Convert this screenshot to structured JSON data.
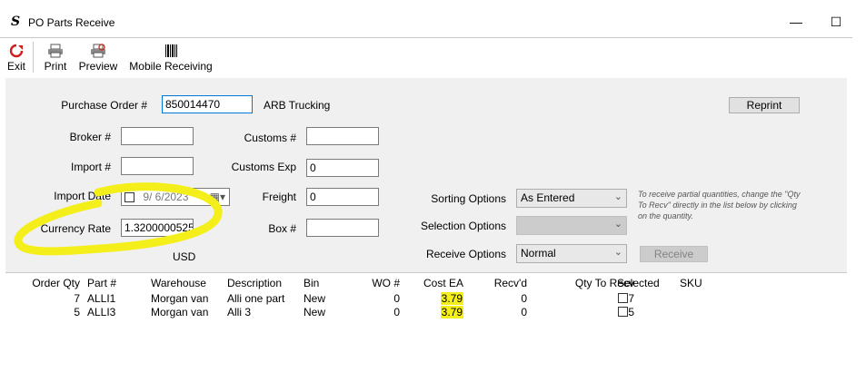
{
  "window": {
    "title": "PO Parts Receive",
    "minimize_label": "—",
    "maximize_label": "☐"
  },
  "toolbar": {
    "exit_label": "Exit",
    "print_label": "Print",
    "preview_label": "Preview",
    "mobile_receiving_label": "Mobile Receiving"
  },
  "form": {
    "purchase_order_label": "Purchase Order #",
    "purchase_order_value": "850014470",
    "vendor_name": "ARB Trucking",
    "reprint_label": "Reprint",
    "broker_label": "Broker #",
    "broker_value": "",
    "customs_label": "Customs #",
    "customs_value": "",
    "import_label": "Import #",
    "import_value": "",
    "customs_exp_label": "Customs Exp",
    "customs_exp_value": "0",
    "import_date_label": "Import Date",
    "import_date_value": "9/  6/2023",
    "freight_label": "Freight",
    "freight_value": "0",
    "currency_rate_label": "Currency Rate",
    "currency_rate_value": "1.3200000525",
    "box_label": "Box #",
    "box_value": "",
    "currency_code": "USD",
    "sorting_options_label": "Sorting Options",
    "sorting_options_value": "As Entered",
    "selection_options_label": "Selection Options",
    "selection_options_value": "",
    "receive_options_label": "Receive Options",
    "receive_options_value": "Normal",
    "receive_button_label": "Receive",
    "hint_text": "To receive partial quantities, change the \"Qty To Recv\" directly in the list below by clicking on the quantity."
  },
  "table": {
    "columns": [
      "Order Qty",
      "Part #",
      "Warehouse",
      "Description",
      "Bin",
      "WO #",
      "Cost EA",
      "Recv'd",
      "Qty To Recv",
      "Selected",
      "SKU"
    ],
    "rows": [
      {
        "order_qty": "7",
        "part": "ALLI1",
        "warehouse": "Morgan van",
        "description": "Alli one part",
        "bin": "New",
        "wo": "0",
        "cost": "3.79",
        "recvd": "0",
        "qty_to_recv": "7",
        "selected": false,
        "sku": ""
      },
      {
        "order_qty": "5",
        "part": "ALLI3",
        "warehouse": "Morgan van",
        "description": "Alli 3",
        "bin": "New",
        "wo": "0",
        "cost": "3.79",
        "recvd": "0",
        "qty_to_recv": "5",
        "selected": false,
        "sku": ""
      }
    ]
  },
  "colors": {
    "highlight": "#f4ef1a",
    "focus_border": "#0078d7",
    "panel_bg": "#f0f0f0"
  },
  "icons": [
    "app-logo-icon",
    "exit-icon",
    "printer-icon",
    "print-preview-icon",
    "barcode-icon",
    "calendar-icon",
    "checkbox-icon"
  ]
}
